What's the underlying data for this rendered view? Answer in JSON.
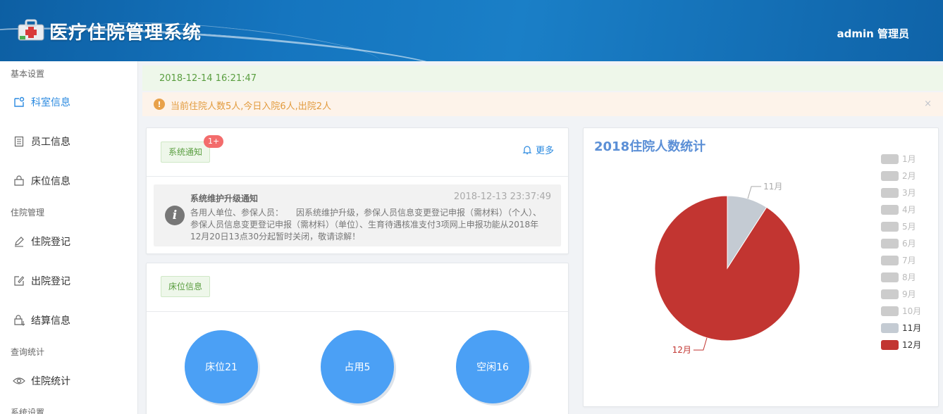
{
  "header": {
    "app_title": "医疗住院管理系统",
    "user": "admin 管理员"
  },
  "sidebar": {
    "sections": [
      {
        "label": "基本设置"
      },
      {
        "label": "住院管理"
      },
      {
        "label": "查询统计"
      },
      {
        "label": "系统设置"
      }
    ],
    "items": [
      {
        "label": "科室信息",
        "icon": "department-icon",
        "active": true
      },
      {
        "label": "员工信息",
        "icon": "document-icon"
      },
      {
        "label": "床位信息",
        "icon": "bag-icon"
      },
      {
        "label": "住院登记",
        "icon": "pen-icon"
      },
      {
        "label": "出院登记",
        "icon": "edit-icon"
      },
      {
        "label": "结算信息",
        "icon": "settlement-icon"
      },
      {
        "label": "住院统计",
        "icon": "eye-icon"
      }
    ]
  },
  "alerts": {
    "datetime": "2018-12-14 16:21:47",
    "summary": "当前住院人数5人,今日入院6人,出院2人",
    "close": "×"
  },
  "notice_card": {
    "tag": "系统通知",
    "badge": "1+",
    "more": "更多",
    "notice": {
      "title": "系统维护升级通知",
      "date": "2018-12-13 23:37:49",
      "body": "各用人单位、参保人员：　　因系统维护升级，参保人员信息变更登记申报（需材料）（个人）、参保人员信息变更登记申报（需材料）（单位）、生育待遇核准支付3项网上申报功能从2018年12月20日13点30分起暂时关闭，敬请谅解！"
    }
  },
  "bed_card": {
    "tag": "床位信息",
    "circles": [
      {
        "label": "床位21"
      },
      {
        "label": "占用5"
      },
      {
        "label": "空闲16"
      }
    ]
  },
  "chart_data": {
    "type": "pie",
    "title": "2018住院人数统计",
    "legend_position": "right",
    "categories": [
      "1月",
      "2月",
      "3月",
      "4月",
      "5月",
      "6月",
      "7月",
      "8月",
      "9月",
      "10月",
      "11月",
      "12月"
    ],
    "values": [
      0,
      0,
      0,
      0,
      0,
      0,
      0,
      0,
      0,
      0,
      1,
      10
    ],
    "colors": [
      "#cccccc",
      "#cccccc",
      "#cccccc",
      "#cccccc",
      "#cccccc",
      "#cccccc",
      "#cccccc",
      "#cccccc",
      "#cccccc",
      "#cccccc",
      "#c4cbd3",
      "#c23531"
    ],
    "inactive_color": "#cccccc",
    "active_legend_colors": {
      "11月": "#c4cbd3",
      "12月": "#c23531"
    },
    "label_colors": {
      "11月": "#aaaaaa",
      "12月": "#c23531"
    }
  }
}
